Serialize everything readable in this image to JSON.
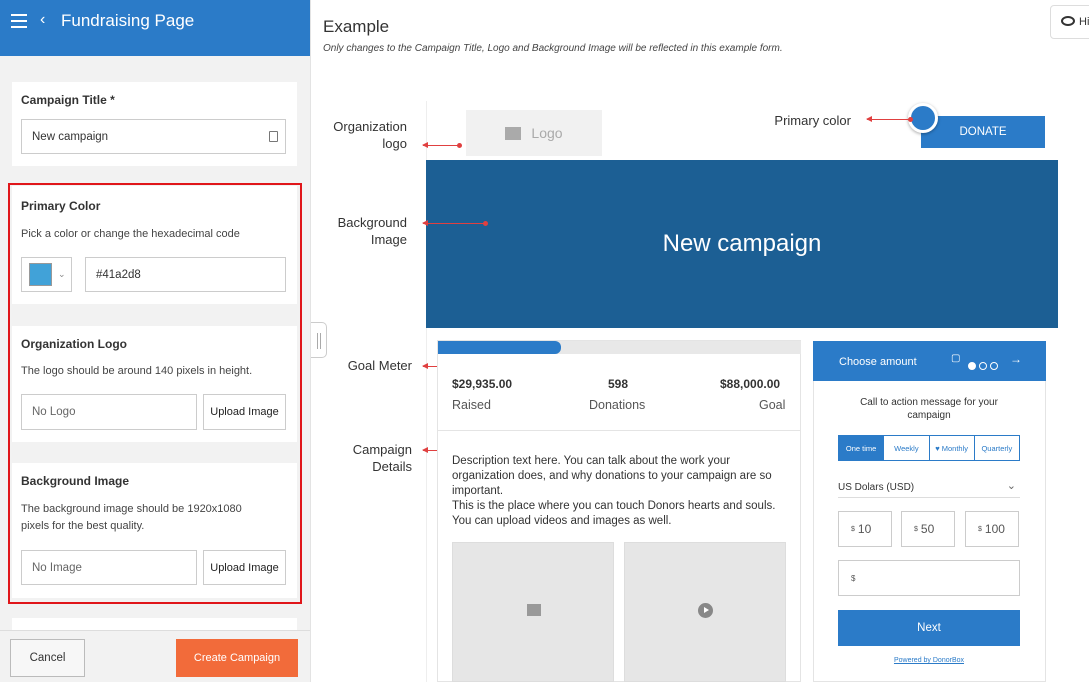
{
  "panel": {
    "title": "Fundraising Page",
    "campaign_title_label": "Campaign Title *",
    "campaign_title_value": "New campaign",
    "primary_color_label": "Primary Color",
    "primary_color_desc": "Pick a color or change the hexadecimal code",
    "primary_color_hex": "#41a2d8",
    "org_logo_label": "Organization Logo",
    "org_logo_desc": "The logo should be around 140 pixels in height.",
    "org_logo_placeholder": "No Logo",
    "bg_image_label": "Background Image",
    "bg_image_desc_1": "The background image should be 1920x1080",
    "bg_image_desc_2": "pixels for the best quality.",
    "bg_image_placeholder": "No Image",
    "upload_label": "Upload Image",
    "cancel_label": "Cancel",
    "create_label": "Create Campaign"
  },
  "example": {
    "title": "Example",
    "subtitle": "Only changes to the Campaign Title, Logo and Background Image will be reflected in this example form.",
    "hide_label": "Hi"
  },
  "annotations": {
    "org_logo": "Organization logo",
    "bg_image": "Background Image",
    "goal_meter": "Goal Meter",
    "campaign_details": "Campaign Details",
    "primary_color": "Primary color"
  },
  "preview": {
    "logo_text": "Logo",
    "donate_label": "DONATE",
    "hero_title": "New campaign",
    "goal_progress": 0.34,
    "raised_value": "$29,935.00",
    "raised_label": "Raised",
    "donations_value": "598",
    "donations_label": "Donations",
    "goal_value": "$88,000.00",
    "goal_label": "Goal",
    "description": [
      "Description text here. You can talk about the work your organization does, and why donations to your campaign are so important.",
      "This is the place where you can touch Donors hearts and souls. You can upload videos and images as well."
    ],
    "choose_amount": "Choose amount",
    "cta": "Call to action message for your campaign",
    "frequencies": [
      "One time",
      "Weekly",
      "♥ Monthly",
      "Quarterly"
    ],
    "currency": "US Dolars (USD)",
    "amounts": [
      "10",
      "50",
      "100"
    ],
    "currency_symbol": "$",
    "next_label": "Next",
    "powered": "Powered by DonorBox"
  },
  "colors": {
    "brand": "#2b7bc8",
    "hero": "#1c5f94",
    "create": "#f26b3a",
    "highlight": "#e0161a",
    "swatch": "#41a2d8"
  }
}
